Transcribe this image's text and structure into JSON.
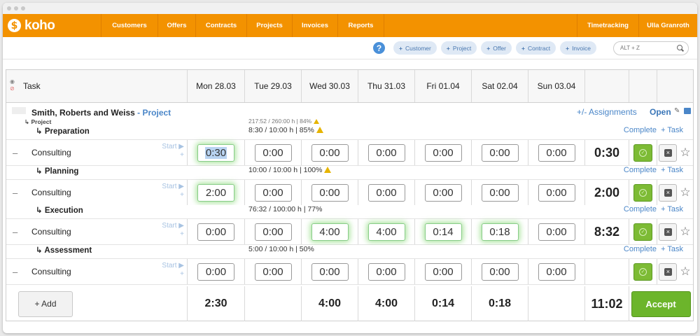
{
  "nav": {
    "logo": "koho",
    "items": [
      "Customers",
      "Offers",
      "Contracts",
      "Projects",
      "Invoices",
      "Reports"
    ],
    "timetracking": "Timetracking",
    "user": "Ulla Granroth"
  },
  "toolbar": {
    "pills": [
      "Customer",
      "Project",
      "Offer",
      "Contract",
      "Invoice"
    ],
    "search_placeholder": "ALT + Z"
  },
  "header": {
    "task": "Task",
    "days": [
      "Mon 28.03",
      "Tue 29.03",
      "Wed 30.03",
      "Thu 31.03",
      "Fri 01.04",
      "Sat 02.04",
      "Sun 03.04"
    ]
  },
  "project": {
    "client": "Smith, Roberts and Weiss",
    "separator": " - ",
    "label": "Project",
    "sub": "Project",
    "stats": "217:52 / 260:00 h | 84%",
    "assignments": "+/- Assignments",
    "open": "Open"
  },
  "phases": [
    {
      "name": "Preparation",
      "stats": "8:30 / 10:00 h | 85%",
      "warn": true,
      "row": {
        "task": "Consulting",
        "values": [
          "0:30",
          "0:00",
          "0:00",
          "0:00",
          "0:00",
          "0:00",
          "0:00"
        ],
        "total": "0:30"
      }
    },
    {
      "name": "Planning",
      "stats": "10:00 / 10:00 h | 100%",
      "warn": true,
      "row": {
        "task": "Consulting",
        "values": [
          "2:00",
          "0:00",
          "0:00",
          "0:00",
          "0:00",
          "0:00",
          "0:00"
        ],
        "total": "2:00"
      }
    },
    {
      "name": "Execution",
      "stats": "76:32 / 100:00 h | 77%",
      "warn": false,
      "row": {
        "task": "Consulting",
        "values": [
          "0:00",
          "0:00",
          "4:00",
          "4:00",
          "0:14",
          "0:18",
          "0:00"
        ],
        "total": "8:32"
      }
    },
    {
      "name": "Assessment",
      "stats": "5:00 / 10:00 h | 50%",
      "warn": false,
      "row": {
        "task": "Consulting",
        "values": [
          "0:00",
          "0:00",
          "0:00",
          "0:00",
          "0:00",
          "0:00",
          "0:00"
        ],
        "total": ""
      }
    }
  ],
  "phase_links": {
    "complete": "Complete",
    "add_task": "+ Task"
  },
  "row_labels": {
    "start": "Start"
  },
  "footer": {
    "add": "+ Add",
    "totals": [
      "2:30",
      "",
      "4:00",
      "4:00",
      "0:14",
      "0:18",
      ""
    ],
    "grand_total": "11:02",
    "accept": "Accept"
  }
}
